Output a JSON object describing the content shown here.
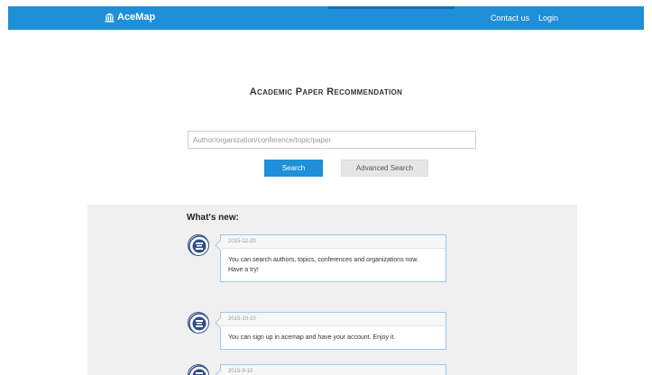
{
  "navbar": {
    "brand": "AceMap",
    "links": [
      "Contact us",
      "Login"
    ]
  },
  "main": {
    "title": "Academic Paper Recommendation",
    "search": {
      "placeholder": "Author/organization/conference/topic/paper",
      "value": ""
    },
    "buttons": {
      "search": "Search",
      "advanced": "Advanced Search"
    }
  },
  "news": {
    "heading": "What's new:",
    "items": [
      {
        "date": "2015-12-20",
        "lines": [
          "You can search authors, topics, conferences and organizations now.",
          "Have a try!"
        ]
      },
      {
        "date": "2015-10-10",
        "lines": [
          "You can sign up in acemap and have your account. Enjoy it."
        ]
      },
      {
        "date": "2015-9-10",
        "lines": []
      }
    ]
  },
  "colors": {
    "primary": "#1e8fd8",
    "panel": "#f0f0f0",
    "card_border": "#9dc9e8"
  }
}
